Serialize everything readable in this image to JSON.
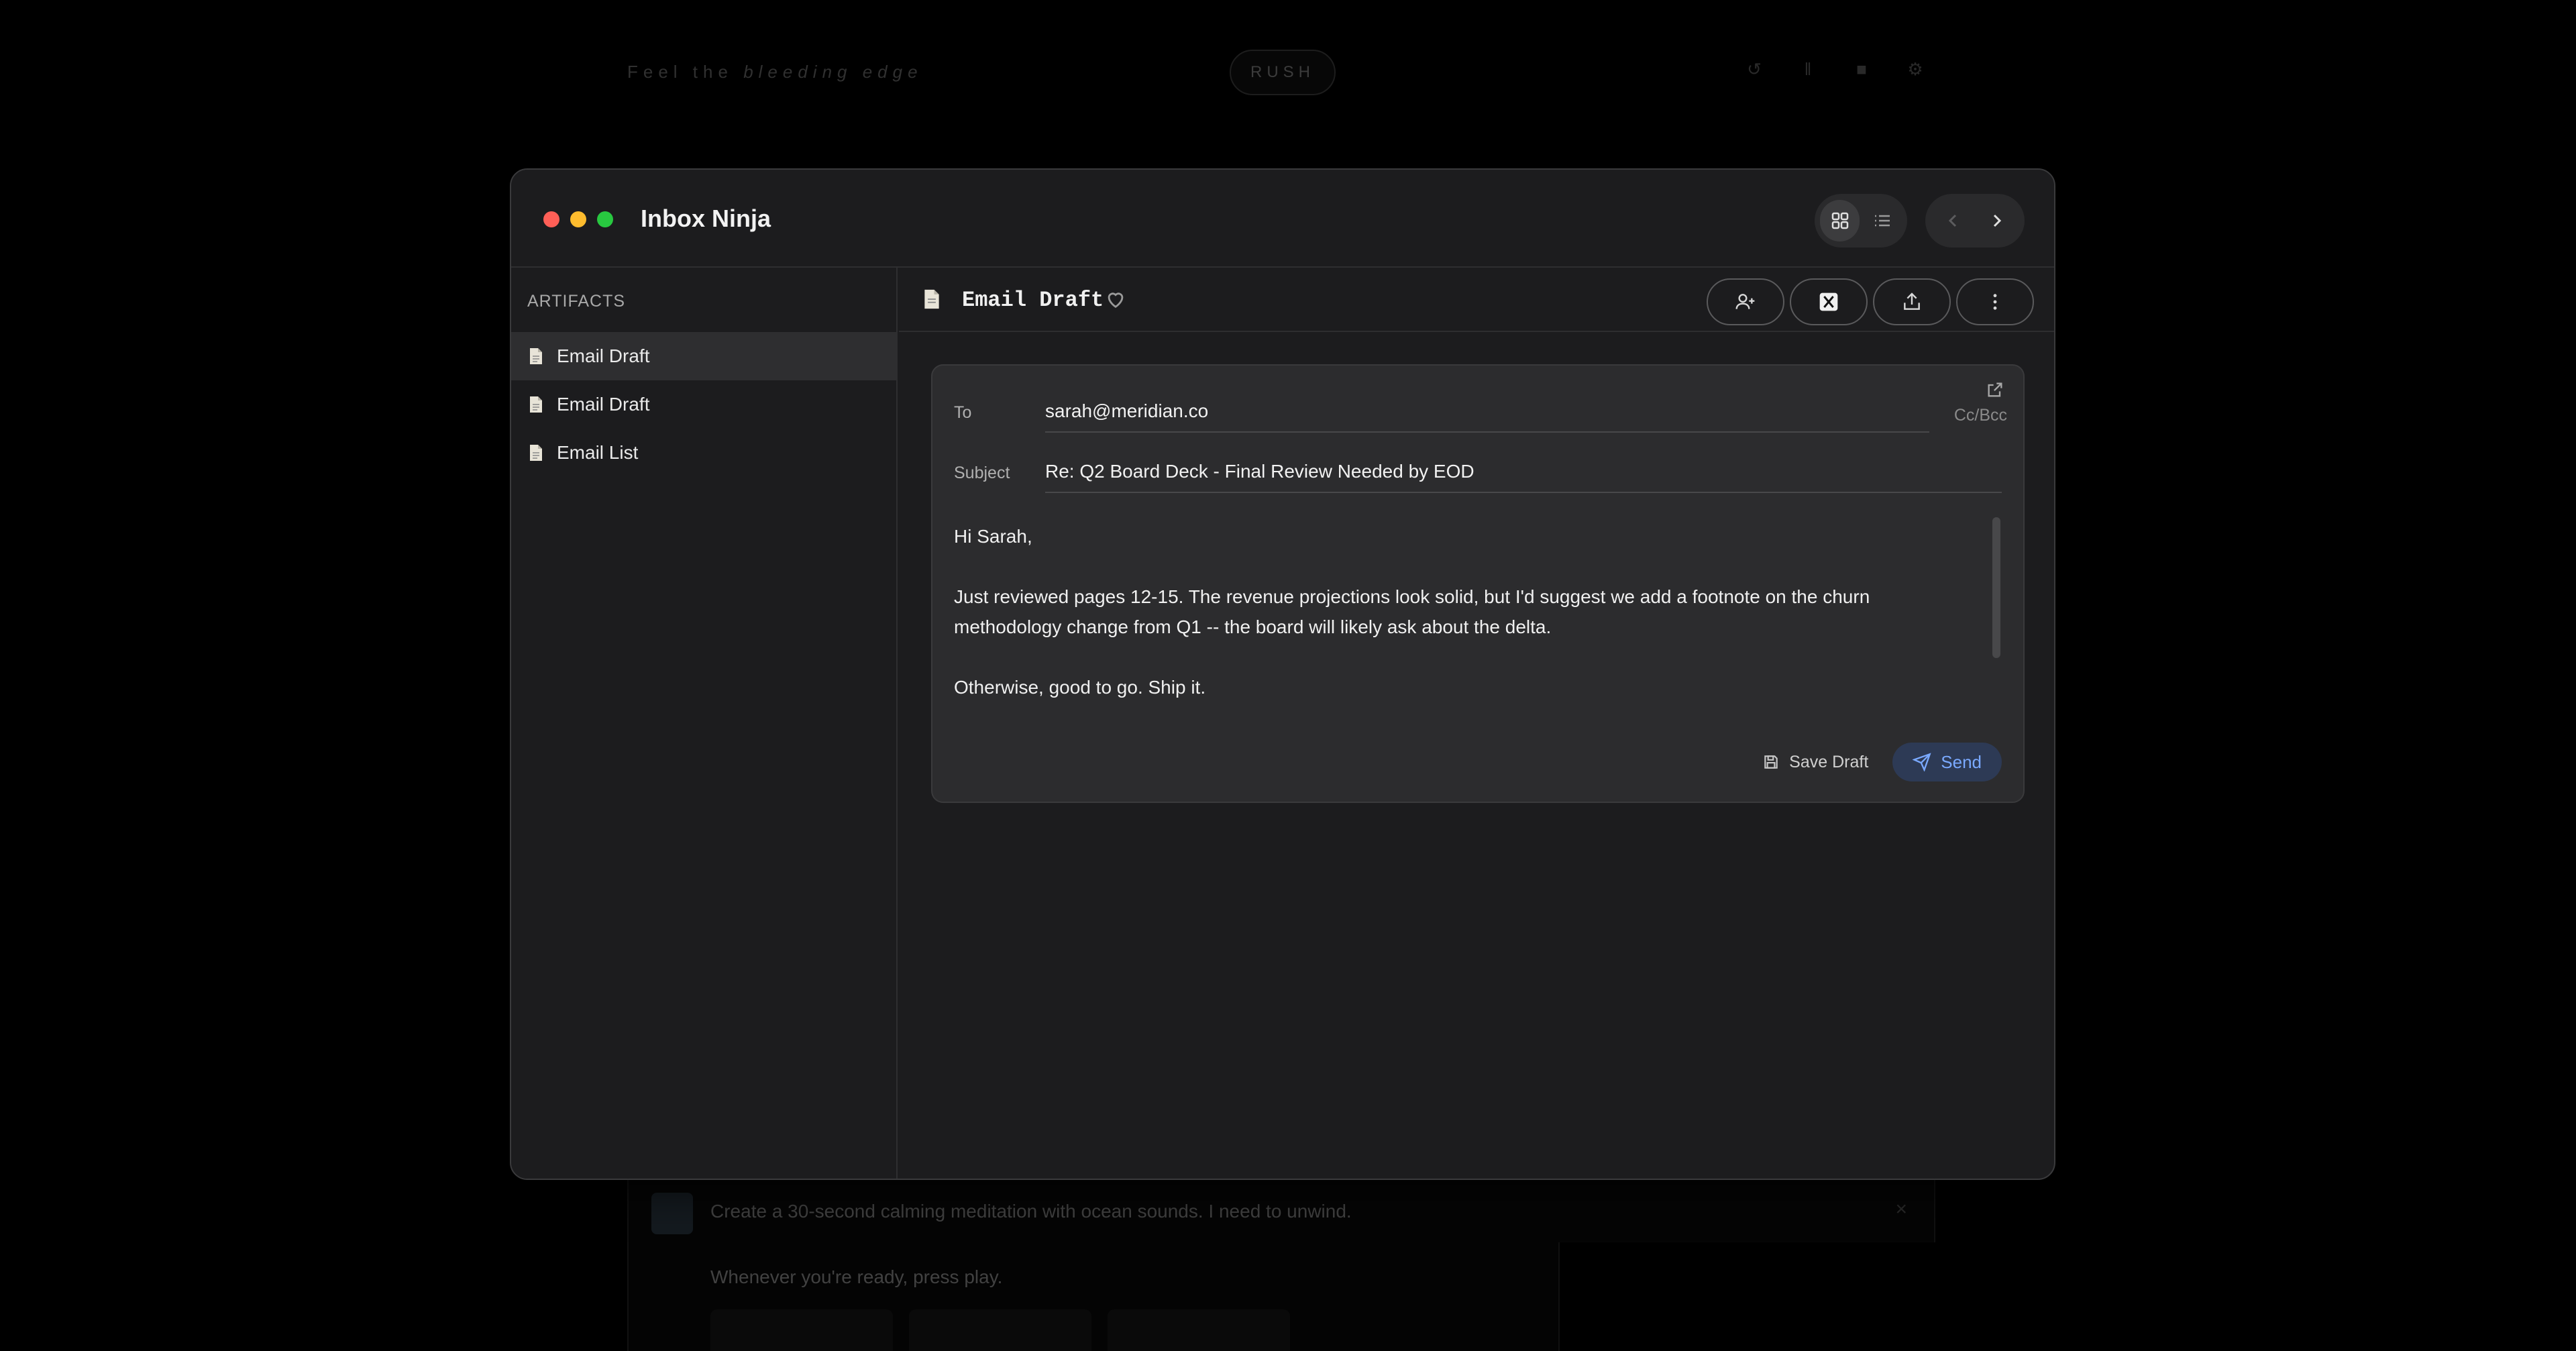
{
  "background": {
    "tagline_prefix": "Feel the",
    "tagline_emphasis": "bleeding edge",
    "rush_label": "RUSH",
    "prompt_text": "Create a 30-second calming meditation with ocean sounds. I need to unwind.",
    "response_text": "Whenever you're ready, press play."
  },
  "window": {
    "title": "Inbox Ninja"
  },
  "sidebar": {
    "heading": "ARTIFACTS",
    "items": [
      {
        "label": "Email Draft"
      },
      {
        "label": "Email Draft"
      },
      {
        "label": "Email List"
      }
    ]
  },
  "content": {
    "title": "Email Draft"
  },
  "email": {
    "to_label": "To",
    "to_value": "sarah@meridian.co",
    "ccbcc_label": "Cc/Bcc",
    "subject_label": "Subject",
    "subject_value": "Re: Q2 Board Deck - Final Review Needed by EOD",
    "body": [
      "Hi Sarah,",
      "Just reviewed pages 12-15. The revenue projections look solid, but I'd suggest we add a footnote on the churn methodology change from Q1 -- the board will likely ask about the delta.",
      "Otherwise, good to go. Ship it."
    ],
    "save_label": "Save Draft",
    "send_label": "Send"
  },
  "colors": {
    "accent": "#7aa9ff",
    "traffic_red": "#ff5f57",
    "traffic_yellow": "#febc2e",
    "traffic_green": "#28c840"
  }
}
